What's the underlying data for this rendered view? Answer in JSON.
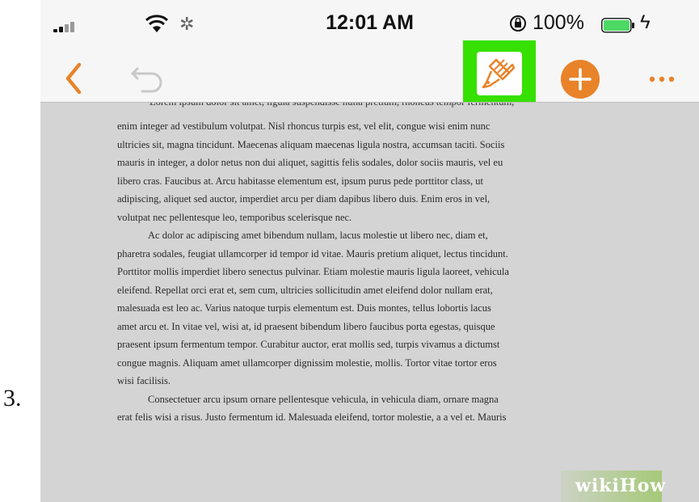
{
  "step": {
    "number": "3."
  },
  "status_bar": {
    "time": "12:01 AM",
    "battery_percent": "100%",
    "battery_level": 1.0,
    "battery_color": "#4cd964"
  },
  "toolbar": {
    "accent_color": "#e8832a",
    "highlight_color": "#36e000",
    "back_icon": "chevron-left-icon",
    "undo_icon": "undo-icon",
    "format_icon": "paintbrush-icon",
    "add_icon": "plus-icon",
    "more_icon": "ellipsis-icon"
  },
  "document": {
    "cut_line": "Lorem ipsum dolor sit amet, ligula suspendisse nulla pretium, rhoncus tempor fermentum,",
    "lines": [
      "enim integer ad vestibulum volutpat. Nisl rhoncus turpis est, vel elit, congue wisi enim nunc",
      "ultricies sit, magna tincidunt. Maecenas aliquam maecenas ligula nostra, accumsan taciti. Sociis",
      "mauris in integer, a dolor netus non dui aliquet, sagittis felis sodales, dolor sociis mauris, vel eu",
      "libero cras. Faucibus at. Arcu habitasse elementum est, ipsum purus pede porttitor class, ut",
      "adipiscing, aliquet sed auctor, imperdiet arcu per diam dapibus libero duis. Enim eros in vel,",
      "volutpat nec pellentesque leo, temporibus scelerisque nec.",
      "Ac dolor ac adipiscing amet bibendum nullam, lacus molestie ut libero nec, diam et,",
      "pharetra sodales, feugiat ullamcorper id tempor id vitae. Mauris pretium aliquet, lectus tincidunt.",
      "Porttitor mollis imperdiet libero senectus pulvinar. Etiam molestie mauris ligula laoreet, vehicula",
      "eleifend. Repellat orci erat et, sem cum, ultricies sollicitudin amet eleifend dolor nullam erat,",
      "malesuada est leo ac. Varius natoque turpis elementum est. Duis montes, tellus lobortis lacus",
      "amet arcu et. In vitae vel, wisi at, id praesent bibendum libero faucibus porta egestas, quisque",
      "praesent ipsum fermentum tempor. Curabitur auctor, erat mollis sed, turpis vivamus a dictumst",
      "congue magnis. Aliquam amet ullamcorper dignissim molestie, mollis. Tortor vitae tortor eros",
      "wisi facilisis.",
      "Consectetuer arcu ipsum ornare pellentesque vehicula, in vehicula diam, ornare magna",
      "erat felis wisi a risus. Justo fermentum id. Malesuada eleifend, tortor molestie, a a vel et. Mauris"
    ]
  },
  "watermark": {
    "wiki": "wiki",
    "how": "How"
  }
}
